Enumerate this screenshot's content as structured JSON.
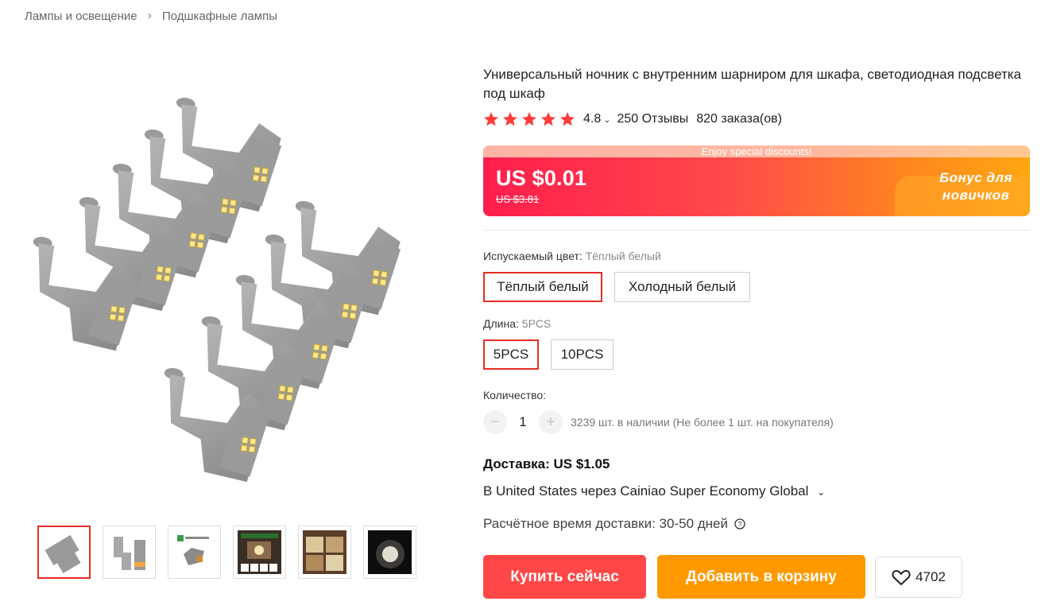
{
  "breadcrumb": [
    "Лампы и освещение",
    "Подшкафные лампы"
  ],
  "product": {
    "title": "Универсальный ночник с внутренним шарниром для шкафа, светодиодная подсветка под шкаф",
    "rating": "4.8",
    "rating_fraction": 0.96,
    "reviews": "250 Отзывы",
    "orders": "820 заказа(ов)"
  },
  "price": {
    "banner": "Enjoy special discounts!",
    "current": "US $0.01",
    "old": "US $3.81",
    "bonus_line1": "Бонус для",
    "bonus_line2": "новичков"
  },
  "color": {
    "label": "Испускаемый цвет:",
    "selected": "Тёплый белый",
    "options": [
      "Тёплый белый",
      "Холодный белый"
    ]
  },
  "length": {
    "label": "Длина:",
    "selected": "5PCS",
    "options": [
      "5PCS",
      "10PCS"
    ]
  },
  "quantity": {
    "label": "Количество:",
    "value": "1",
    "minus": "−",
    "plus": "+",
    "stock": "3239 шт. в наличии (Не более 1 шт. на покупателя)"
  },
  "shipping": {
    "price": "Доставка: US $1.05",
    "via": "В United States через Cainiao Super Economy Global",
    "time": "Расчётное время доставки: 30-50 дней"
  },
  "actions": {
    "buy": "Купить сейчас",
    "cart": "Добавить в корзину",
    "wishlist_count": "4702"
  },
  "colors": {
    "accent": "#ff4747",
    "cart": "#ff9900",
    "star": "#ff3b3b",
    "selected_border": "#e62e24"
  }
}
